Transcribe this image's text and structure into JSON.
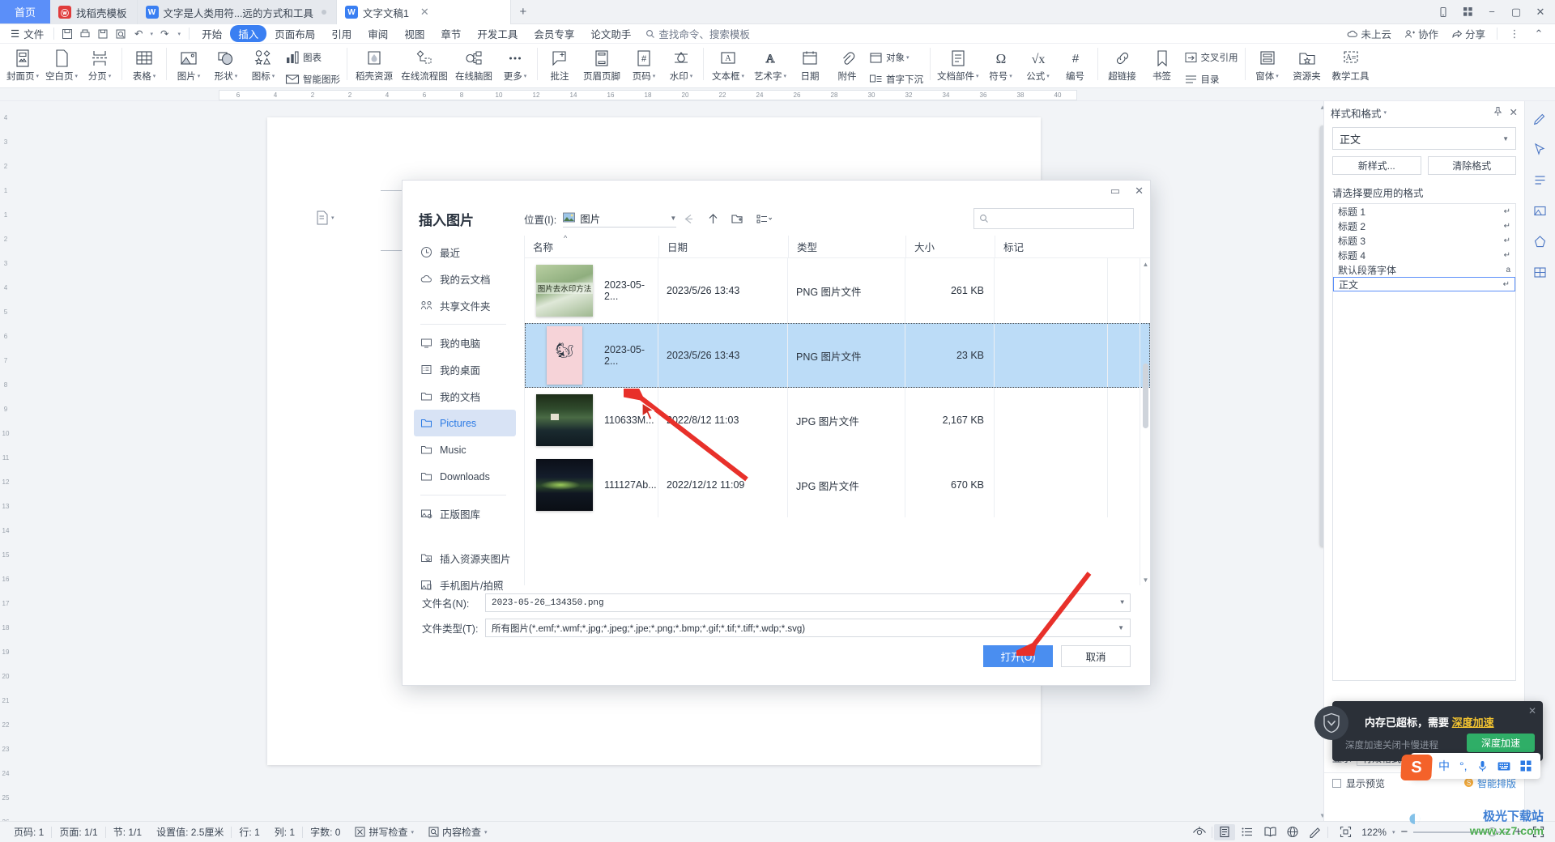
{
  "tabbar": {
    "home_label": "首页",
    "tabs": [
      {
        "label": "找稻壳模板",
        "icon": "wps-template-icon",
        "badge": "",
        "active": false
      },
      {
        "label": "文字是人类用符...远的方式和工具",
        "icon": "wps-writer-icon",
        "badge": "dot",
        "active": false
      },
      {
        "label": "文字文稿1",
        "icon": "wps-writer-icon",
        "badge": "",
        "active": true
      }
    ],
    "new_tab": "+",
    "right_buttons": [
      "mobile-icon",
      "grid-icon",
      "minimize-icon",
      "maximize-icon",
      "close-icon"
    ]
  },
  "menu": {
    "hamburger": "☰",
    "file_label": "文件",
    "quick_icons": [
      "save-icon",
      "print-icon",
      "print-preview-icon",
      "find-icon",
      "undo-icon",
      "redo-icon",
      "customize-icon"
    ],
    "ribbon_tabs": [
      {
        "label": "开始",
        "selected": false
      },
      {
        "label": "插入",
        "selected": true
      },
      {
        "label": "页面布局",
        "selected": false
      },
      {
        "label": "引用",
        "selected": false
      },
      {
        "label": "审阅",
        "selected": false
      },
      {
        "label": "视图",
        "selected": false
      },
      {
        "label": "章节",
        "selected": false
      },
      {
        "label": "开发工具",
        "selected": false
      },
      {
        "label": "会员专享",
        "selected": false
      },
      {
        "label": "论文助手",
        "selected": false
      }
    ],
    "search_placeholder": "查找命令、搜索模板",
    "right_items": [
      {
        "label": "未上云",
        "icon": "cloud-icon"
      },
      {
        "label": "协作",
        "icon": "collaborate-icon"
      },
      {
        "label": "分享",
        "icon": "share-icon"
      }
    ],
    "more_icon": "more-vertical-icon",
    "collapse_icon": "chevron-up-icon"
  },
  "ribbon": {
    "groups": [
      {
        "items": [
          {
            "label": "封面页",
            "icon": "cover-page-icon",
            "caret": true
          },
          {
            "label": "空白页",
            "icon": "blank-page-icon",
            "caret": true
          },
          {
            "label": "分页",
            "icon": "page-break-icon",
            "caret": true
          }
        ]
      },
      {
        "items": [
          {
            "label": "表格",
            "icon": "table-icon",
            "caret": true
          }
        ]
      },
      {
        "items": [
          {
            "label": "图片",
            "icon": "picture-icon",
            "caret": true
          },
          {
            "label": "形状",
            "icon": "shapes-icon",
            "caret": true
          },
          {
            "label": "图标",
            "icon": "icons-icon",
            "caret": true
          }
        ]
      },
      {
        "stack": [
          {
            "label": "图表",
            "icon": "chart-icon"
          },
          {
            "label": "智能图形",
            "icon": "smartart-icon"
          }
        ]
      },
      {
        "items": [
          {
            "label": "稻壳资源",
            "icon": "docer-icon"
          },
          {
            "label": "在线流程图",
            "icon": "flowchart-icon"
          },
          {
            "label": "在线脑图",
            "icon": "mindmap-icon"
          },
          {
            "label": "更多",
            "icon": "more-dots-icon",
            "caret": true
          }
        ]
      },
      {
        "items": [
          {
            "label": "批注",
            "icon": "comment-icon"
          },
          {
            "label": "页眉页脚",
            "icon": "header-footer-icon"
          },
          {
            "label": "页码",
            "icon": "page-number-icon",
            "caret": true
          },
          {
            "label": "水印",
            "icon": "watermark-icon",
            "caret": true
          }
        ]
      },
      {
        "items": [
          {
            "label": "文本框",
            "icon": "textbox-icon",
            "caret": true
          },
          {
            "label": "艺术字",
            "icon": "wordart-icon",
            "caret": true
          },
          {
            "label": "日期",
            "icon": "date-icon"
          },
          {
            "label": "附件",
            "icon": "attachment-icon"
          }
        ]
      },
      {
        "stack": [
          {
            "label": "对象",
            "icon": "object-icon",
            "caret": true
          },
          {
            "label": "首字下沉",
            "icon": "drop-cap-icon"
          }
        ]
      },
      {
        "items": [
          {
            "label": "文档部件",
            "icon": "doc-parts-icon",
            "caret": true
          },
          {
            "label": "符号",
            "icon": "symbol-icon",
            "caret": true
          },
          {
            "label": "公式",
            "icon": "formula-icon",
            "caret": true
          },
          {
            "label": "编号",
            "icon": "numbering-icon"
          }
        ]
      },
      {
        "items": [
          {
            "label": "超链接",
            "icon": "hyperlink-icon"
          },
          {
            "label": "书签",
            "icon": "bookmark-icon"
          }
        ]
      },
      {
        "stack": [
          {
            "label": "交叉引用",
            "icon": "cross-ref-icon"
          },
          {
            "label": "目录",
            "icon": "toc-icon"
          }
        ]
      },
      {
        "items": [
          {
            "label": "窗体",
            "icon": "form-icon",
            "caret": true
          },
          {
            "label": "资源夹",
            "icon": "resource-folder-icon"
          },
          {
            "label": "教学工具",
            "icon": "teaching-tools-icon"
          }
        ]
      }
    ]
  },
  "ruler": {
    "marks": [
      "6",
      "4",
      "2",
      "2",
      "4",
      "6",
      "8",
      "10",
      "12",
      "14",
      "16",
      "18",
      "20",
      "22",
      "24",
      "26",
      "28",
      "30",
      "32",
      "34",
      "36",
      "38",
      "40"
    ],
    "vertical_marks": [
      "4",
      "3",
      "2",
      "1",
      "1",
      "2",
      "3",
      "4",
      "5",
      "6",
      "7",
      "8",
      "9",
      "10",
      "11",
      "12",
      "13",
      "14",
      "15",
      "16",
      "17",
      "18",
      "19",
      "20",
      "21",
      "22",
      "23",
      "24",
      "25",
      "26"
    ]
  },
  "dialog": {
    "title": "插入图片",
    "location_label": "位置(I):",
    "location_value": "图片",
    "location_icon": "picture-folder-icon",
    "nav": {
      "history_icon": "chevron-down-icon",
      "back_icon": "arrow-left-icon",
      "up_icon": "arrow-up-icon",
      "new_folder_icon": "new-folder-icon",
      "view_icon": "view-mode-icon"
    },
    "search_placeholder": "",
    "search_icon": "search-icon",
    "window_buttons": {
      "restore": "restore-icon",
      "close": "close-icon"
    },
    "sidebar": [
      {
        "label": "最近",
        "icon": "clock-icon",
        "active": false
      },
      {
        "label": "我的云文档",
        "icon": "cloud-icon",
        "active": false
      },
      {
        "label": "共享文件夹",
        "icon": "shared-folder-icon",
        "active": false
      },
      {
        "divider": true
      },
      {
        "label": "我的电脑",
        "icon": "computer-icon",
        "active": false
      },
      {
        "label": "我的桌面",
        "icon": "desktop-icon",
        "active": false
      },
      {
        "label": "我的文档",
        "icon": "folder-icon",
        "active": false
      },
      {
        "label": "Pictures",
        "icon": "folder-icon",
        "active": true
      },
      {
        "label": "Music",
        "icon": "folder-icon",
        "active": false
      },
      {
        "label": "Downloads",
        "icon": "folder-icon",
        "active": false
      },
      {
        "divider": true
      },
      {
        "label": "正版图库",
        "icon": "image-library-icon",
        "active": false
      },
      {
        "gap": true
      },
      {
        "label": "插入资源夹图片",
        "icon": "insert-resource-icon",
        "active": false
      },
      {
        "label": "手机图片/拍照",
        "icon": "phone-photo-icon",
        "active": false
      }
    ],
    "columns": [
      "名称",
      "日期",
      "类型",
      "大小",
      "标记"
    ],
    "sort_indicator": "^",
    "files": [
      {
        "name": "2023-05-2...",
        "date": "2023/5/26 13:43",
        "type": "PNG 图片文件",
        "size": "261 KB",
        "tag": "",
        "thumb": "green-plant-photo",
        "thumb_caption": "图片去水印方法",
        "selected": false
      },
      {
        "name": "2023-05-2...",
        "date": "2023/5/26 13:43",
        "type": "PNG 图片文件",
        "size": "23 KB",
        "tag": "",
        "thumb": "pink-cartoon-photo",
        "thumb_caption": "",
        "selected": true
      },
      {
        "name": "110633M...",
        "date": "2022/8/12 11:03",
        "type": "JPG 图片文件",
        "size": "2,167 KB",
        "tag": "",
        "thumb": "forest-lake-photo",
        "thumb_caption": "",
        "selected": false
      },
      {
        "name": "111127Ab...",
        "date": "2022/12/12 11:09",
        "type": "JPG 图片文件",
        "size": "670 KB",
        "tag": "",
        "thumb": "aurora-night-photo",
        "thumb_caption": "",
        "selected": false
      }
    ],
    "filename_label": "文件名(N):",
    "filename_value": "2023-05-26_134350.png",
    "filetype_label": "文件类型(T):",
    "filetype_value": "所有图片(*.emf;*.wmf;*.jpg;*.jpeg;*.jpe;*.png;*.bmp;*.gif;*.tif;*.tiff;*.wdp;*.svg)",
    "open_button": "打开(O)",
    "open_button_accel": "O",
    "cancel_button": "取消"
  },
  "style_panel": {
    "title": "样式和格式",
    "pin_icon": "pin-icon",
    "close_icon": "close-icon",
    "current_style": "正文",
    "new_style_button": "新样式...",
    "clear_format_button": "清除格式",
    "hint": "请选择要应用的格式",
    "items": [
      {
        "label": "标题 1",
        "mark": "↵",
        "selected": false
      },
      {
        "label": "标题 2",
        "mark": "↵",
        "selected": false
      },
      {
        "label": "标题 3",
        "mark": "↵",
        "selected": false
      },
      {
        "label": "标题 4",
        "mark": "↵",
        "selected": false
      },
      {
        "label": "默认段落字体",
        "mark": "a",
        "selected": false
      },
      {
        "label": "正文",
        "mark": "↵",
        "selected": true
      }
    ],
    "show_label": "显示",
    "show_value": "有效格式",
    "preview_checkbox": "显示预览",
    "smart_typeset": "智能排版"
  },
  "icon_rail": [
    "edit-pen-icon",
    "cursor-icon",
    "paragraph-icon",
    "image-tools-icon",
    "shapes-tool-icon",
    "table-tool-icon"
  ],
  "statusbar": {
    "left": [
      {
        "label": "页码: 1"
      },
      {
        "label": "页面: 1/1"
      },
      {
        "label": "节: 1/1"
      },
      {
        "label": "设置值: 2.5厘米"
      },
      {
        "label": "行: 1"
      },
      {
        "label": "列: 1"
      },
      {
        "label": "字数: 0"
      },
      {
        "label": "拼写检查",
        "icon": "spellcheck-icon",
        "caret": true
      },
      {
        "label": "内容检查",
        "icon": "content-check-icon",
        "caret": true
      }
    ],
    "view_icons": [
      "read-eye-icon",
      "page-view-icon",
      "outline-view-icon",
      "reading-view-icon",
      "web-view-icon",
      "edit-view-icon"
    ],
    "fit_icon": "fit-page-icon",
    "zoom": "122%",
    "zoom_out": "−",
    "zoom_in": "+",
    "fullscreen_icon": "fullscreen-icon"
  },
  "toast": {
    "icon": "shield-icon",
    "message_prefix": "内存已超标，需要 ",
    "message_highlight": "深度加速",
    "subtext": "深度加速关闭卡慢进程",
    "action_button": "深度加速",
    "close": "✕"
  },
  "ime": {
    "logo": "S",
    "mode": "中",
    "punctuation": "°,",
    "mic_icon": "microphone-icon",
    "keyboard_icon": "keyboard-icon",
    "apps_icon": "apps-icon"
  },
  "watermark": {
    "line1": "极光下载站",
    "line2": "www.xz7.com"
  },
  "colors": {
    "accent": "#4a8ef0",
    "home_tab": "#5b8ff9",
    "selection": "#bcdcf7",
    "sidebar_active": "#d8e3f5",
    "arrow_red": "#e8302a"
  }
}
